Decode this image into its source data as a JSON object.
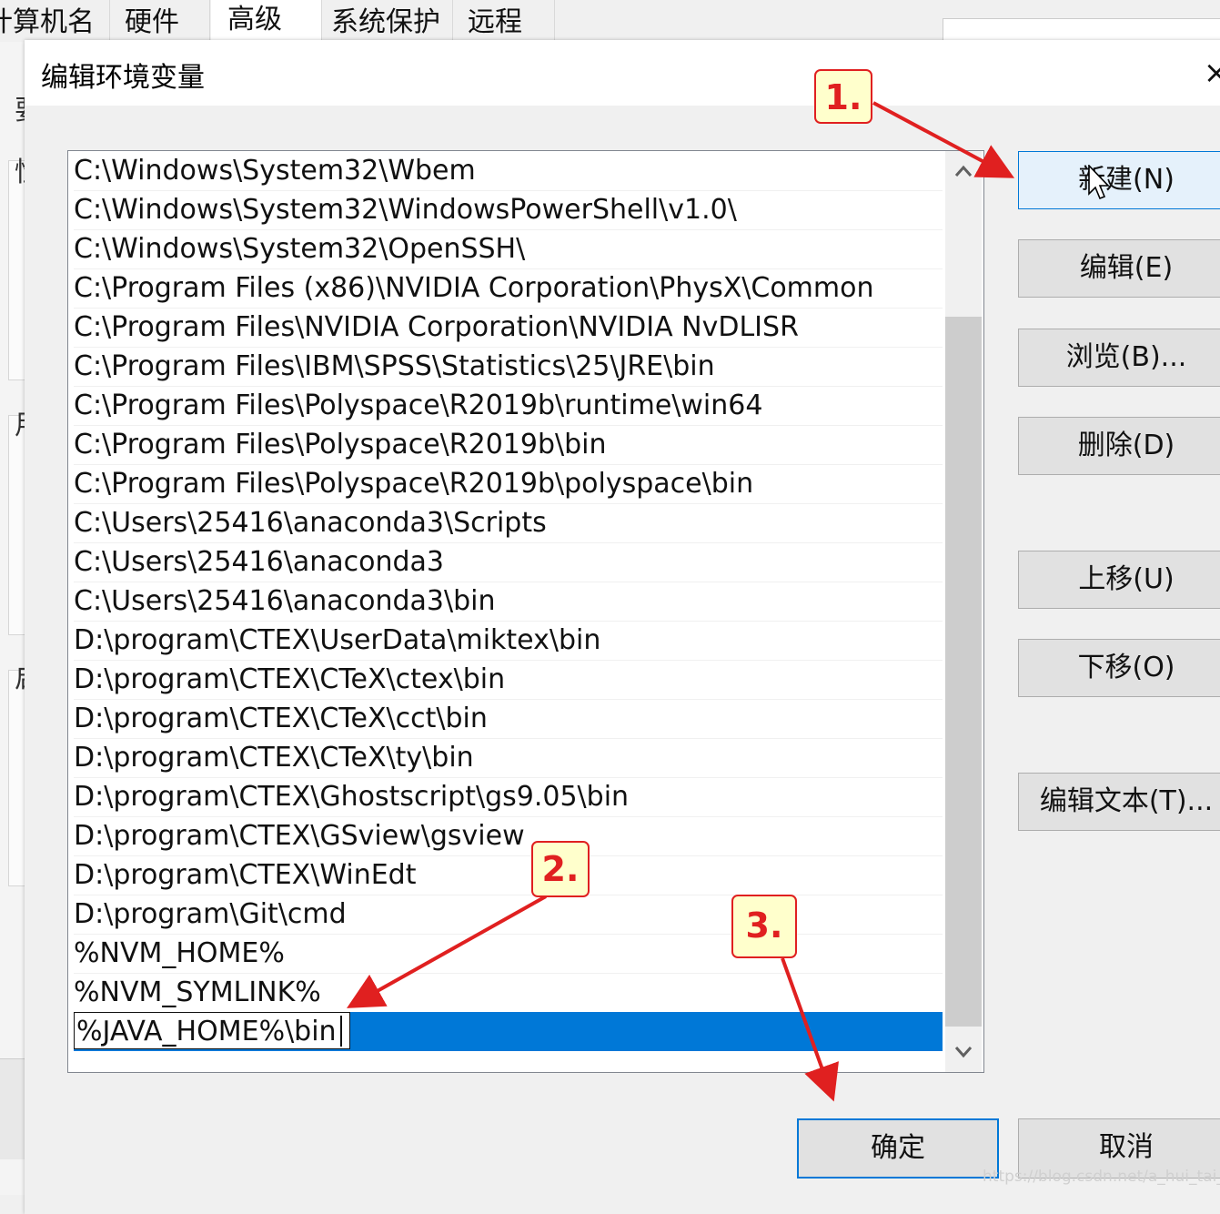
{
  "background_window": {
    "tabs": [
      "计算机名",
      "硬件",
      "高级",
      "系统保护",
      "远程"
    ],
    "left_fragments": [
      "要",
      "性",
      "用",
      "启"
    ]
  },
  "dialog": {
    "title": "编辑环境变量",
    "close_glyph": "×",
    "path_entries": [
      "C:\\Windows\\System32\\Wbem",
      "C:\\Windows\\System32\\WindowsPowerShell\\v1.0\\",
      "C:\\Windows\\System32\\OpenSSH\\",
      "C:\\Program Files (x86)\\NVIDIA Corporation\\PhysX\\Common",
      "C:\\Program Files\\NVIDIA Corporation\\NVIDIA NvDLISR",
      "C:\\Program Files\\IBM\\SPSS\\Statistics\\25\\JRE\\bin",
      "C:\\Program Files\\Polyspace\\R2019b\\runtime\\win64",
      "C:\\Program Files\\Polyspace\\R2019b\\bin",
      "C:\\Program Files\\Polyspace\\R2019b\\polyspace\\bin",
      "C:\\Users\\25416\\anaconda3\\Scripts",
      "C:\\Users\\25416\\anaconda3",
      "C:\\Users\\25416\\anaconda3\\bin",
      "D:\\program\\CTEX\\UserData\\miktex\\bin",
      "D:\\program\\CTEX\\CTeX\\ctex\\bin",
      "D:\\program\\CTEX\\CTeX\\cct\\bin",
      "D:\\program\\CTEX\\CTeX\\ty\\bin",
      "D:\\program\\CTEX\\Ghostscript\\gs9.05\\bin",
      "D:\\program\\CTEX\\GSview\\gsview",
      "D:\\program\\CTEX\\WinEdt",
      "D:\\program\\Git\\cmd",
      "%NVM_HOME%",
      "%NVM_SYMLINK%"
    ],
    "editing_entry": "%JAVA_HOME%\\bin",
    "buttons": {
      "new": "新建(N)",
      "edit": "编辑(E)",
      "browse": "浏览(B)...",
      "delete": "删除(D)",
      "move_up": "上移(U)",
      "move_down": "下移(O)",
      "edit_text": "编辑文本(T)...",
      "ok": "确定",
      "cancel": "取消"
    },
    "scroll_up_icon": "chevron-up-icon",
    "scroll_down_icon": "chevron-down-icon"
  },
  "annotations": {
    "step1": "1.",
    "step2": "2.",
    "step3": "3.",
    "color": "#e02020"
  },
  "watermark": "https://blog.csdn.net/a_hui_tai_lang"
}
